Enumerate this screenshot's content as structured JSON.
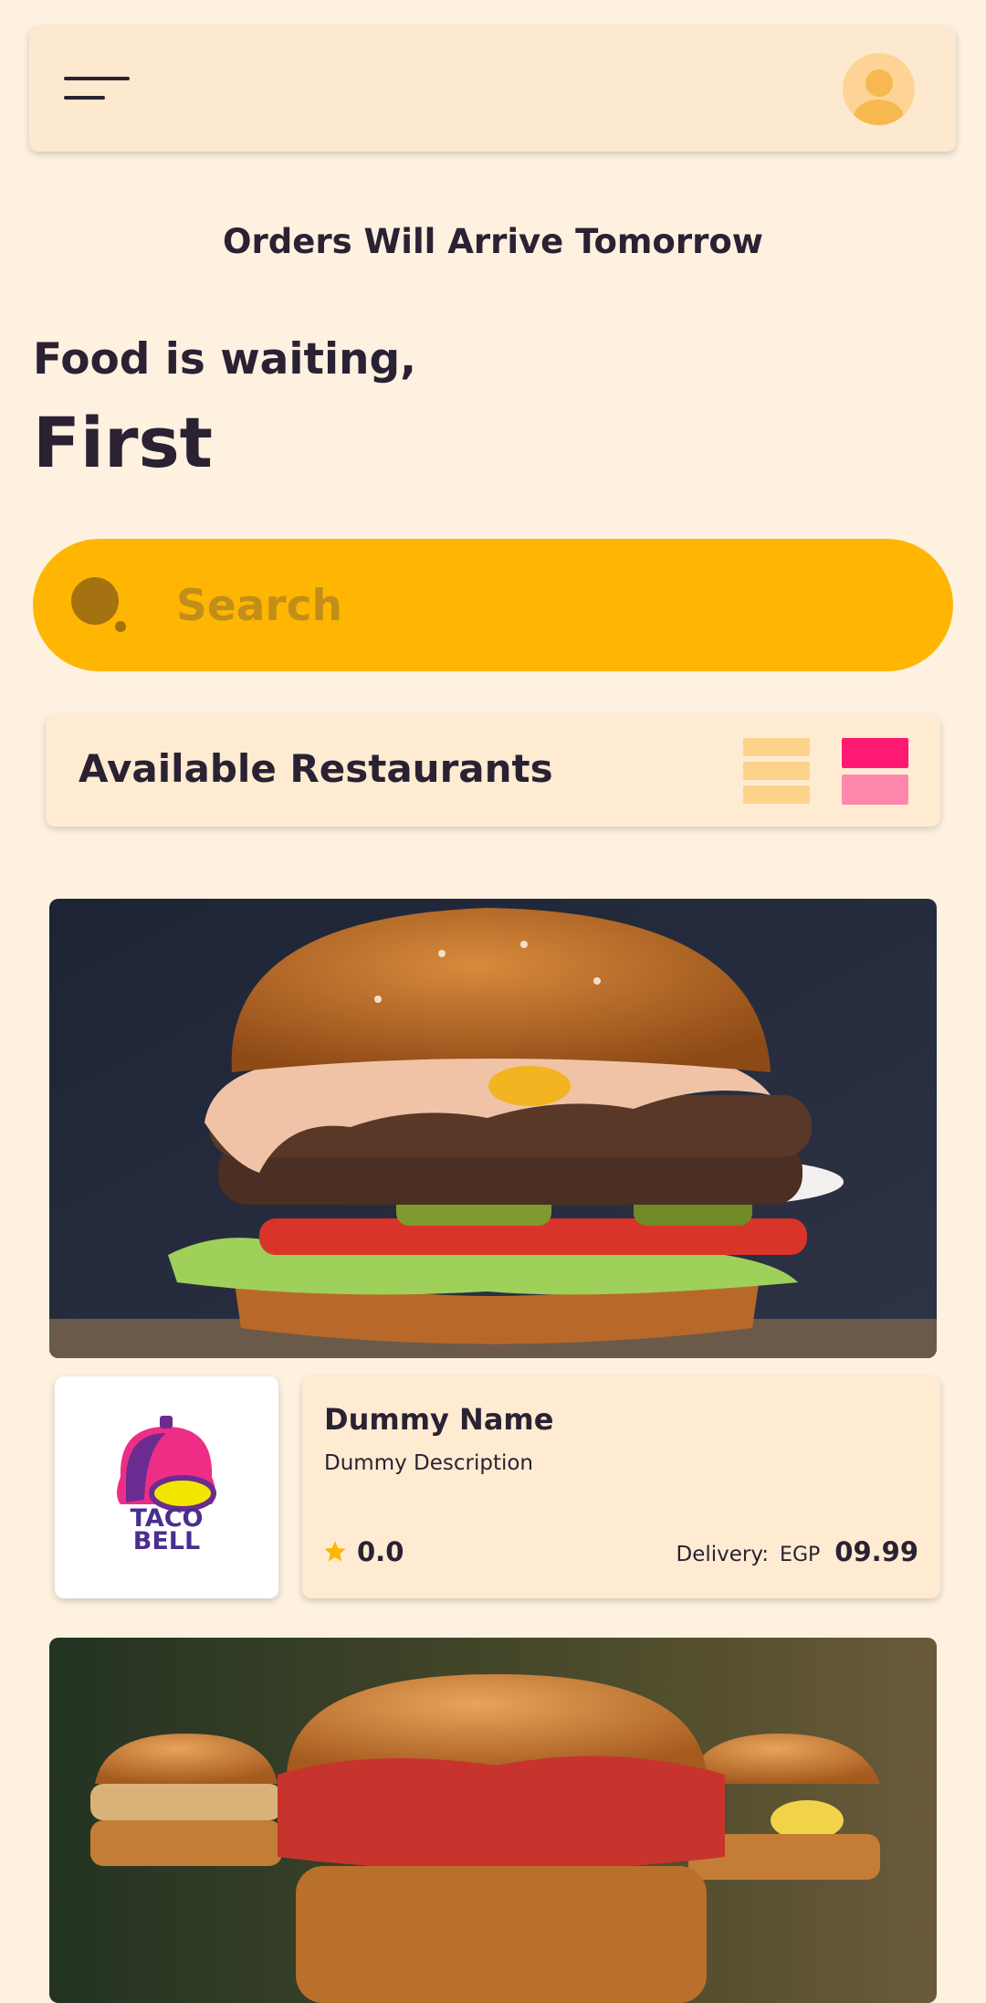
{
  "header": {
    "menu_icon": "hamburger-menu-icon",
    "avatar_icon": "user-avatar-icon"
  },
  "banner": {
    "arrival_text": "Orders Will Arrive Tomorrow",
    "greeting": "Food is waiting,",
    "user_name": "First"
  },
  "search": {
    "placeholder": "Search",
    "value": ""
  },
  "restaurants_section": {
    "title": "Available Restaurants",
    "list_view_icon": "list-view-icon",
    "grid_view_icon": "card-view-icon"
  },
  "restaurants": [
    {
      "name": "Dummy Name",
      "description": "Dummy Description",
      "rating": "0.0",
      "delivery_label": "Delivery:",
      "currency": "EGP",
      "delivery_fee": "09.99",
      "logo_line1": "TACO",
      "logo_line2": "BELL"
    }
  ],
  "colors": {
    "background": "#fef1e0",
    "accent_yellow": "#feb602",
    "accent_pink": "#fe1a73",
    "text_dark": "#2a2233"
  }
}
